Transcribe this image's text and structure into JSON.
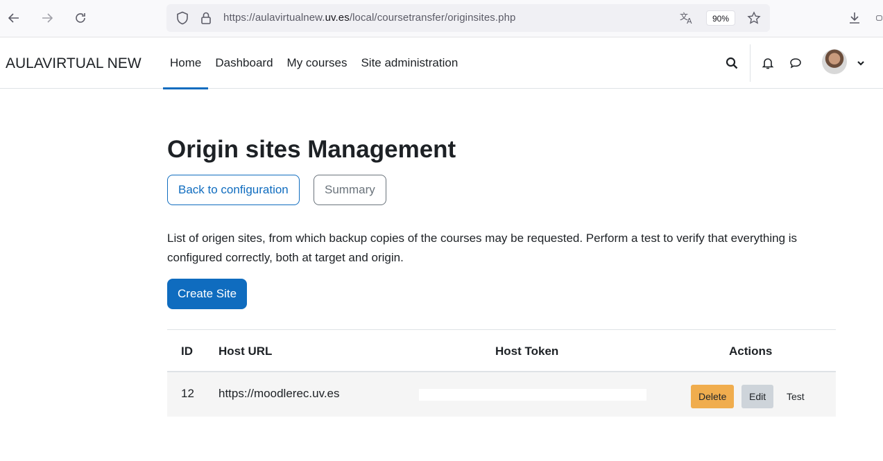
{
  "browser": {
    "url_prefix": "https://aulavirtualnew.",
    "url_domain": "uv.es",
    "url_path": "/local/coursetransfer/originsites.php",
    "zoom": "90%"
  },
  "navbar": {
    "brand": "AULAVIRTUAL NEW",
    "links": [
      {
        "label": "Home",
        "active": true
      },
      {
        "label": "Dashboard",
        "active": false
      },
      {
        "label": "My courses",
        "active": false
      },
      {
        "label": "Site administration",
        "active": false
      }
    ]
  },
  "main": {
    "title": "Origin sites Management",
    "back_button": "Back to configuration",
    "summary_button": "Summary",
    "description": "List of origen sites, from which backup copies of the courses may be requested. Perform a test to verify that everything is configured correctly, both at target and origin.",
    "create_button": "Create Site"
  },
  "table": {
    "headers": {
      "id": "ID",
      "host_url": "Host URL",
      "host_token": "Host Token",
      "actions": "Actions"
    },
    "rows": [
      {
        "id": "12",
        "host_url": "https://moodlerec.uv.es",
        "host_token": "",
        "delete": "Delete",
        "edit": "Edit",
        "test": "Test"
      }
    ]
  },
  "colors": {
    "primary": "#0f6cbf",
    "warning": "#f0ad4e",
    "secondary": "#ced4da"
  }
}
